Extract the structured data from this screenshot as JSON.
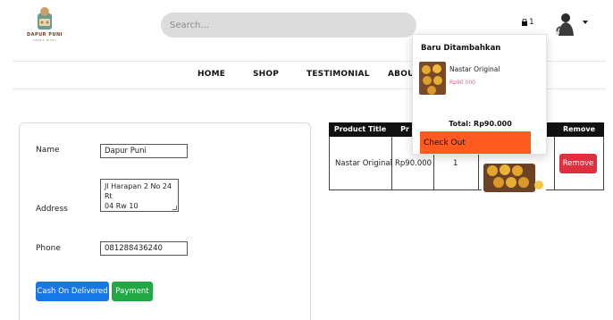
{
  "header": {
    "logo": {
      "brand": "DAPUR PUNI",
      "tagline": "SWEET BITES"
    },
    "search": {
      "placeholder": "Search...",
      "value": ""
    },
    "cart": {
      "icon": "shopping-bag-icon",
      "count": "1"
    },
    "avatar": {
      "icon": "user-avatar"
    }
  },
  "nav": {
    "items": [
      "HOME",
      "SHOP",
      "TESTIMONIAL",
      "ABOUT"
    ]
  },
  "form": {
    "name_label": "Name",
    "name_value": "Dapur Puni",
    "address_label": "Address",
    "address_line1": "Jl Harapan 2 No 24 Rt",
    "address_line2": "04 Rw 10",
    "phone_label": "Phone",
    "phone_value": "081288436240",
    "cod_button": "Cash On Delivered",
    "payment_button": "Payment"
  },
  "table": {
    "headers": [
      "Product Title",
      "Pr",
      "",
      "",
      "Remove"
    ],
    "rows": [
      {
        "title": "Nastar Original",
        "price": "Rp90.000",
        "qty": "1",
        "remove": "Remove"
      }
    ]
  },
  "cart_dropdown": {
    "title": "Baru Ditambahkan",
    "item_name": "Nastar Original",
    "item_price": "Rp90.000",
    "total": "Total: Rp90.000",
    "checkout": "Check Out"
  },
  "colors": {
    "cod": "#1877e6",
    "payment": "#22a745",
    "remove": "#e0303f",
    "checkout": "#ff5a1f",
    "price_accent": "#e8568a",
    "table_header": "#111111"
  }
}
